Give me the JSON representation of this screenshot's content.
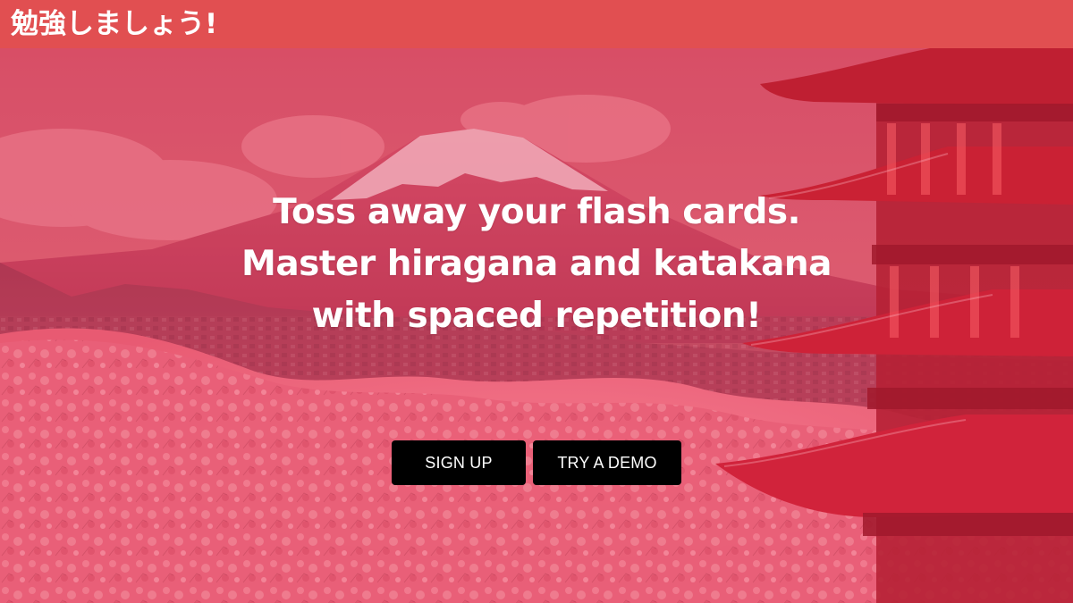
{
  "header": {
    "brand": "勉強しましょう!"
  },
  "hero": {
    "headline_lines": [
      "Toss away your flash cards.",
      "Master hiragana and katakana",
      "with spaced repetition!"
    ],
    "buttons": {
      "signup": "SIGN UP",
      "demo": "TRY A DEMO"
    }
  },
  "colors": {
    "header_bg": "#e14f51",
    "overlay_tint": "#ec2d55",
    "button_bg": "#000000",
    "text": "#ffffff"
  }
}
